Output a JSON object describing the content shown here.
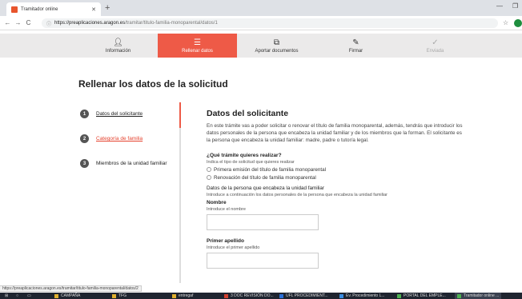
{
  "browser": {
    "tab_title": "Tramitador online",
    "url_host": "https://preaplicaciones.aragon.es",
    "url_path": "/tramitar/titulo-familia-monoparental/datos/1",
    "status_url": "https://preaplicaciones.aragon.es/tramitar/titulo-familia-monoparental/datos/2"
  },
  "steps": [
    {
      "label": "Información",
      "icon": "person-icon"
    },
    {
      "label": "Rellenar datos",
      "icon": "menu-icon"
    },
    {
      "label": "Aportar documentos",
      "icon": "documents-icon"
    },
    {
      "label": "Firmar",
      "icon": "pen-icon"
    },
    {
      "label": "Enviada",
      "icon": "check-icon"
    }
  ],
  "page_title": "Rellenar los datos de la solicitud",
  "sidebar": [
    {
      "num": "1",
      "label": "Datos del solicitante"
    },
    {
      "num": "2",
      "label": "Categoría de familia"
    },
    {
      "num": "3",
      "label": "Miembros de la unidad familiar"
    }
  ],
  "main": {
    "heading": "Datos del solicitante",
    "intro": "En este trámite vas a poder solicitar o renovar el título de familia monoparental, además, tendrás que introducir los datos personales de la persona que encabeza la unidad familiar y de los miembros que la forman. El solicitante es la persona que encabeza la unidad familiar: madre, padre o tutor/a legal.",
    "question": "¿Qué trámite quieres realizar?",
    "question_hint": "Indica el tipo de solicitud que quieres realizar",
    "options": [
      "Primera emisión del título de familia monoparental",
      "Renovación del título de familia monoparental"
    ],
    "section_title": "Datos de la persona que encabeza la unidad familiar",
    "section_hint": "Introduce a continuación los datos personales de la persona que encabeza la unidad familiar",
    "name_label": "Nombre",
    "name_hint": "Introduce el nombre",
    "surname_label": "Primer apellido",
    "surname_hint": "Introduce el primer apellido"
  },
  "taskbar": [
    "CAMPAÑA",
    "TFG",
    "entregaf",
    "3 DOC REVISIÓN DO...",
    "UFL PROCEDIMIENT...",
    "Ev. Procedimiento L...",
    "PORTAL DEL EMPLE...",
    "Tramitador online ..."
  ]
}
